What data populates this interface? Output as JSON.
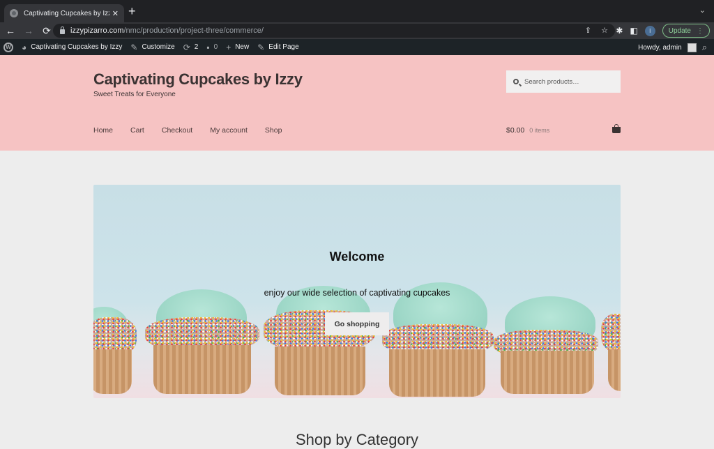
{
  "browser": {
    "tab_title": "Captivating Cupcakes by Izzy",
    "tab_close": "✕",
    "new_tab": "+",
    "tabs_menu": "⌄",
    "back": "←",
    "forward": "→",
    "reload": "⟳",
    "url_host": "izzypizarro.com",
    "url_path": "/nmc/production/project-three/commerce/",
    "share_icon": "⇪",
    "bookmark_icon": "☆",
    "extensions_icon": "✱",
    "sidepanel_icon": "◧",
    "profile_initial": "i",
    "update_label": "Update",
    "menu_icon": "⋮"
  },
  "adminbar": {
    "wp_logo": "W",
    "site_name": "Captivating Cupcakes by Izzy",
    "customize": "Customize",
    "updates_count": "2",
    "comments_count": "0",
    "new_label": "New",
    "edit_page": "Edit Page",
    "howdy": "Howdy, admin",
    "icons": {
      "dashboard": "◕",
      "customize": "✎",
      "updates": "⟳",
      "comments": "▪",
      "new": "+",
      "edit": "✎",
      "search": "⌕"
    }
  },
  "site": {
    "title": "Captivating Cupcakes by Izzy",
    "tagline": "Sweet Treats for Everyone",
    "search_placeholder": "Search products…",
    "nav": [
      "Home",
      "Cart",
      "Checkout",
      "My account",
      "Shop"
    ],
    "cart_total": "$0.00",
    "cart_count": "0 items",
    "header_bg": "#f6c3c3"
  },
  "hero": {
    "title": "Welcome",
    "subtitle": "enjoy our wide selection of captivating cupcakes",
    "button": "Go shopping"
  },
  "section": {
    "title": "Shop by Category"
  }
}
